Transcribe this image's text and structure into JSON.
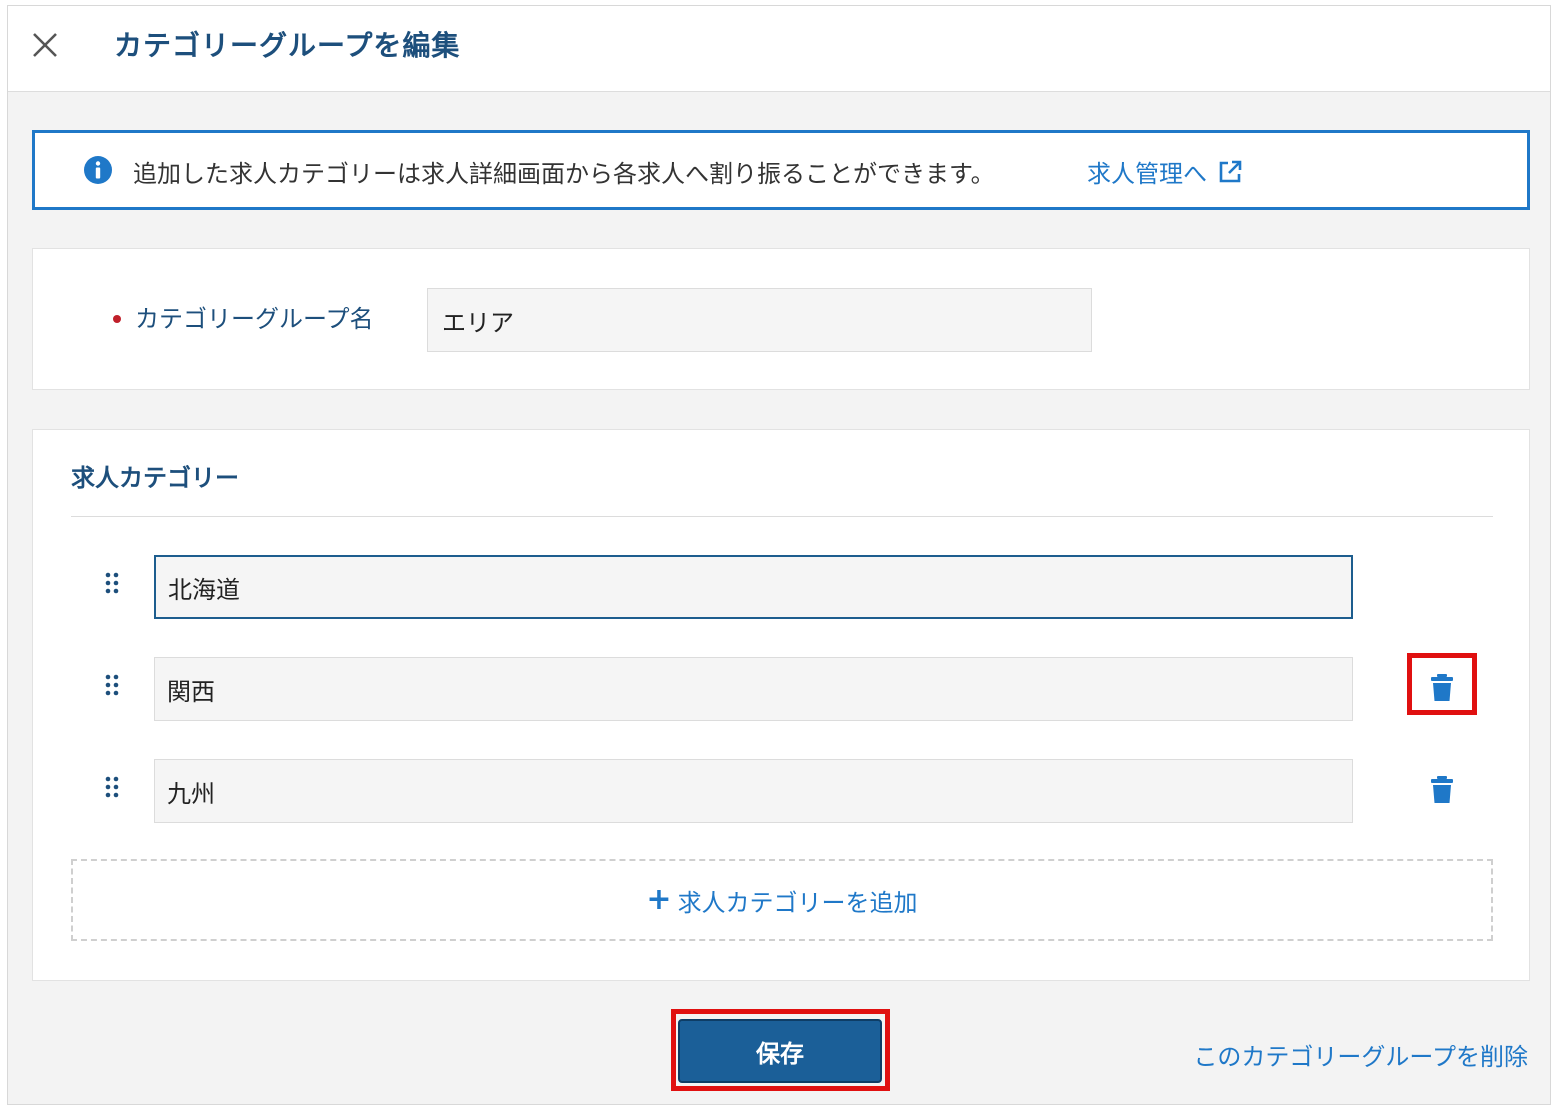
{
  "header": {
    "title": "カテゴリーグループを編集",
    "close_icon": "close-icon"
  },
  "info_banner": {
    "icon": "info-icon",
    "text": "追加した求人カテゴリーは求人詳細画面から各求人へ割り振ることができます。",
    "link_label": "求人管理へ",
    "link_icon": "external-link-icon"
  },
  "group_name": {
    "label": "カテゴリーグループ名",
    "required": true,
    "value": "エリア"
  },
  "categories": {
    "title": "求人カテゴリー",
    "items": [
      {
        "value": "北海道",
        "focused": true,
        "deletable": false
      },
      {
        "value": "関西",
        "focused": false,
        "deletable": true
      },
      {
        "value": "九州",
        "focused": false,
        "deletable": true
      }
    ],
    "add_label": "求人カテゴリーを追加"
  },
  "actions": {
    "save_label": "保存",
    "delete_group_label": "このカテゴリーグループを削除"
  },
  "colors": {
    "accent": "#1f78c8",
    "title": "#1d4f7c",
    "primary_button": "#1b5f98",
    "highlight": "#e01010",
    "required": "#c0202a"
  }
}
